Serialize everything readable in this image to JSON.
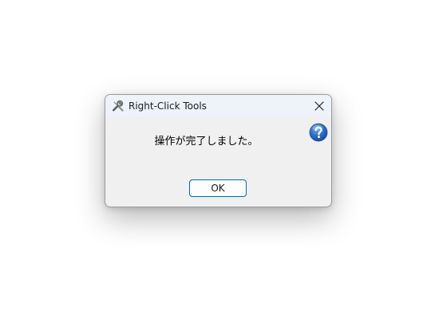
{
  "window": {
    "title": "Right-Click Tools",
    "app_icon": "tools-icon",
    "close_icon": "close-icon"
  },
  "dialog": {
    "icon": "question-icon",
    "message": "操作が完了しました。",
    "ok_label": "OK"
  },
  "colors": {
    "titlebar": "#eef2f9",
    "body": "#f0f0f0",
    "accent": "#0067c0",
    "help_icon": "#2a6cc4"
  }
}
